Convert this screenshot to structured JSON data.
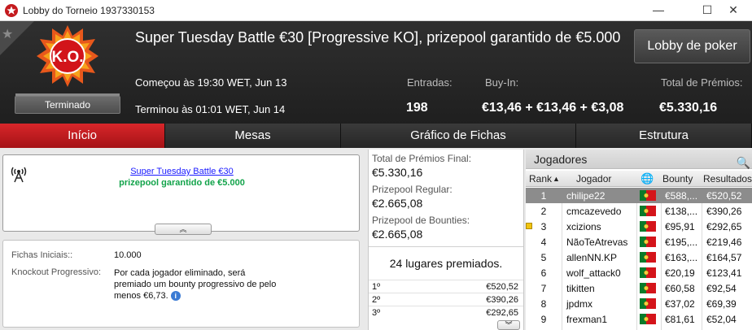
{
  "window": {
    "title": "Lobby do Torneio 1937330153",
    "minimize": "—",
    "maximize": "☐",
    "close": "✕"
  },
  "header": {
    "logo_text": "K.O.",
    "status": "Terminado",
    "title": "Super Tuesday Battle €30 [Progressive KO], prizepool garantido de €5.000",
    "lobby_button": "Lobby de poker",
    "started": "Começou às 19:30 WET, Jun 13",
    "ended": "Terminou às 01:01 WET, Jun 14",
    "entries_label": "Entradas:",
    "entries_value": "198",
    "buyin_label": "Buy-In:",
    "buyin_value": "€13,46 + €13,46 + €3,08",
    "prizes_label": "Total de Prémios:",
    "prizes_value": "€5.330,16"
  },
  "tabs": [
    {
      "label": "Início",
      "active": true
    },
    {
      "label": "Mesas",
      "active": false
    },
    {
      "label": "Gráfico de Fichas",
      "active": false
    },
    {
      "label": "Estrutura",
      "active": false
    }
  ],
  "info": {
    "link": "Super Tuesday Battle €30",
    "guarantee": "prizepool garantido de €5.000",
    "expand": "︽"
  },
  "details": {
    "chips_label": "Fichas Iniciais::",
    "chips_value": "10.000",
    "ko_label": "Knockout Progressivo:",
    "ko_value": "Por cada jogador eliminado, será premiado um bounty progressivo de pelo menos €6,73.",
    "info_icon": "i"
  },
  "prizepool": {
    "final_label": "Total de Prémios Final:",
    "final_value": "€5.330,16",
    "regular_label": "Prizepool Regular:",
    "regular_value": "€2.665,08",
    "bounties_label": "Prizepool de Bounties:",
    "bounties_value": "€2.665,08",
    "places": "24 lugares premiados.",
    "payouts": [
      {
        "pos": "1º",
        "amount": "€520,52"
      },
      {
        "pos": "2º",
        "amount": "€390,26"
      },
      {
        "pos": "3º",
        "amount": "€292,65"
      }
    ],
    "scroll": "︾"
  },
  "players": {
    "title": "Jogadores",
    "columns": {
      "rank": "Rank",
      "player": "Jogador",
      "bounty": "Bounty",
      "results": "Resultados"
    },
    "rows": [
      {
        "rank": "1",
        "name": "chilipe22",
        "bounty": "€588,...",
        "result": "€520,52",
        "selected": true,
        "marker": false
      },
      {
        "rank": "2",
        "name": "cmcazevedo",
        "bounty": "€138,...",
        "result": "€390,26",
        "selected": false,
        "marker": false
      },
      {
        "rank": "3",
        "name": "xcizions",
        "bounty": "€95,91",
        "result": "€292,65",
        "selected": false,
        "marker": true
      },
      {
        "rank": "4",
        "name": "NãoTeAtrevas",
        "bounty": "€195,...",
        "result": "€219,46",
        "selected": false,
        "marker": false
      },
      {
        "rank": "5",
        "name": "allenNN.KP",
        "bounty": "€163,...",
        "result": "€164,57",
        "selected": false,
        "marker": false
      },
      {
        "rank": "6",
        "name": "wolf_attack0",
        "bounty": "€20,19",
        "result": "€123,41",
        "selected": false,
        "marker": false
      },
      {
        "rank": "7",
        "name": "tikitten",
        "bounty": "€60,58",
        "result": "€92,54",
        "selected": false,
        "marker": false
      },
      {
        "rank": "8",
        "name": "jpdmx",
        "bounty": "€37,02",
        "result": "€69,39",
        "selected": false,
        "marker": false
      },
      {
        "rank": "9",
        "name": "frexman1",
        "bounty": "€81,61",
        "result": "€52,04",
        "selected": false,
        "marker": false
      }
    ]
  },
  "colors": {
    "accent": "#c41a1e",
    "header_bg": "#262626",
    "selected_row": "#8c8c8c",
    "green": "#12a34a"
  }
}
